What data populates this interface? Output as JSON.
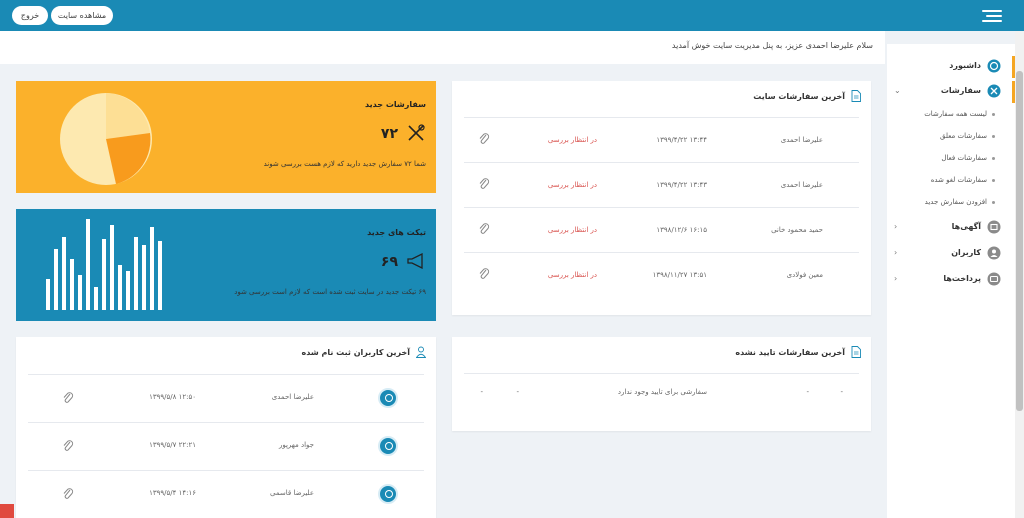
{
  "header": {
    "view_site_label": "مشاهده سایت",
    "logout_label": "خروج",
    "menu_icon": "hamburger-icon",
    "bg_color": "#1a8ab5"
  },
  "welcome": {
    "text": "سلام علیرضا احمدی عزیز، به پنل مدیریت سایت خوش آمدید"
  },
  "sidebar": {
    "items": [
      {
        "label": "داشبورد",
        "icon": "dashboard-icon",
        "active": true
      },
      {
        "label": "سفارشات",
        "icon": "tools-icon",
        "active": true,
        "expanded": true
      },
      {
        "label": "آگهی‌ها",
        "icon": "ads-icon"
      },
      {
        "label": "کاربران",
        "icon": "user-icon"
      },
      {
        "label": "پرداخت‌ها",
        "icon": "wallet-icon"
      }
    ],
    "sub_items": [
      "لیست همه سفارشات",
      "سفارشات معلق",
      "سفارشات فعال",
      "سفارشات لغو شده",
      "افزودن سفارش جدید"
    ]
  },
  "latest_orders": {
    "title": "آخرین سفارشات سایت",
    "rows": [
      {
        "name": "علیرضا احمدی",
        "date": "۱۳۹۹/۴/۲۲ ۱۳:۴۴",
        "status": "در انتظار بررسی"
      },
      {
        "name": "علیرضا احمدی",
        "date": "۱۳۹۹/۴/۲۲ ۱۳:۴۳",
        "status": "در انتظار بررسی"
      },
      {
        "name": "حمید محمود خانی",
        "date": "۱۳۹۸/۱۲/۶ ۱۶:۱۵",
        "status": "در انتظار بررسی"
      },
      {
        "name": "معین فولادی",
        "date": "۱۳۹۸/۱۱/۲۷ ۱۳:۵۱",
        "status": "در انتظار بررسی"
      }
    ]
  },
  "new_orders": {
    "title": "سفارشات جدید",
    "value": "۷۲",
    "description": "شما ۷۲ سفارش جدید دارید که لازم هست بررسی شوند",
    "color": "#fbb12b"
  },
  "new_tickets": {
    "title": "تیکت های جدید",
    "value": "۶۹",
    "description": "۶۹ تیکت جدید در سایت ثبت شده است که لازم است بررسی شود",
    "color": "#1a8ab5"
  },
  "unconfirmed_orders": {
    "title": "آخرین سفارشات تایید نشده",
    "empty_text": "سفارشی برای تایید وجود ندارد",
    "dash": "-"
  },
  "registered_users": {
    "title": "آخرین کاربران ثبت نام شده",
    "rows": [
      {
        "name": "علیرضا احمدی",
        "date": "۱۳۹۹/۵/۸ ۱۲:۵۰"
      },
      {
        "name": "جواد مهرپور",
        "date": "۱۳۹۹/۵/۷ ۲۲:۲۱"
      },
      {
        "name": "علیرضا قاسمی",
        "date": "۱۳۹۹/۵/۴ ۱۴:۱۶"
      }
    ]
  }
}
